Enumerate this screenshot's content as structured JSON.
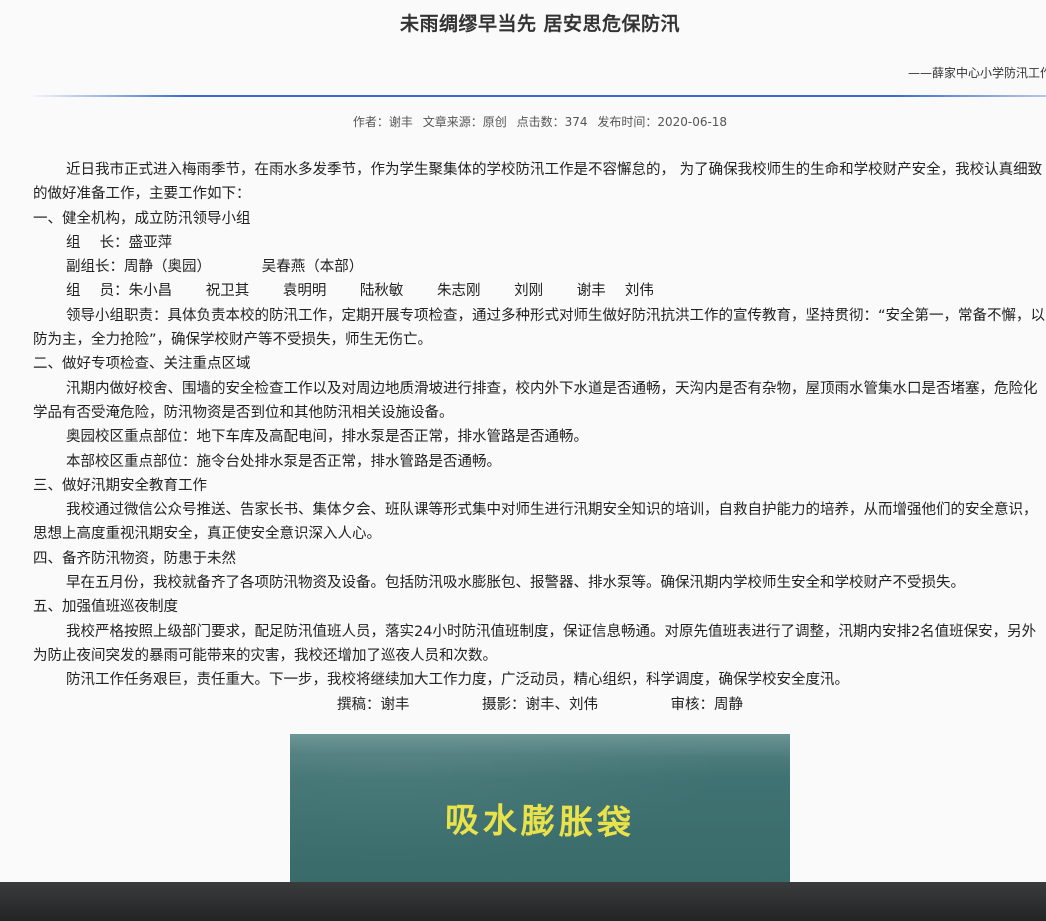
{
  "article": {
    "title": "未雨绸缪早当先 居安思危保防汛",
    "subtitle": "——薛家中心小学防汛工作",
    "meta": {
      "author": "作者：谢丰",
      "source": "文章来源：原创",
      "clicks": "点击数：374",
      "date": "发布时间：2020-06-18"
    },
    "paragraphs": {
      "intro": "近日我市正式进入梅雨季节，在雨水多发季节，作为学生聚集体的学校防汛工作是不容懈怠的， 为了确保我校师生的生命和学校财产安全，我校认真细致的做好准备工作，主要工作如下：",
      "h1": "一、健全机构，成立防汛领导小组",
      "leader": "组　 长：盛亚萍",
      "deputy": "副组长：周静（奥园）　　　　吴春燕（本部）",
      "members": "组　 员：朱小昌　　 祝卫其　　 袁明明　　 陆秋敏　　 朱志刚　　 刘刚　　 谢丰　 刘伟",
      "duty": "领导小组职责：具体负责本校的防汛工作，定期开展专项检查，通过多种形式对师生做好防汛抗洪工作的宣传教育，坚持贯彻：“安全第一，常备不懈，以防为主，全力抢险”，确保学校财产等不受损失，师生无伤亡。",
      "h2": "二、做好专项检查、关注重点区域",
      "check": "汛期内做好校舍、围墙的安全检查工作以及对周边地质滑坡进行排查，校内外下水道是否通畅，天沟内是否有杂物，屋顶雨水管集水口是否堵塞，危险化学品有否受淹危险，防汛物资是否到位和其他防汛相关设施设备。",
      "aoyuan": "奥园校区重点部位：地下车库及高配电间，排水泵是否正常，排水管路是否通畅。",
      "benbu": "本部校区重点部位：施令台处排水泵是否正常，排水管路是否通畅。",
      "h3": "三、做好汛期安全教育工作",
      "edu": "我校通过微信公众号推送、告家长书、集体夕会、班队课等形式集中对师生进行汛期安全知识的培训，自救自护能力的培养，从而增强他们的安全意识，思想上高度重视汛期安全，真正使安全意识深入人心。",
      "h4": "四、备齐防汛物资，防患于未然",
      "supplies": "早在五月份，我校就备齐了各项防汛物资及设备。包括防汛吸水膨胀包、报警器、排水泵等。确保汛期内学校师生安全和学校财产不受损失。",
      "h5": "五、加强值班巡夜制度",
      "duty2": "我校严格按照上级部门要求，配足防汛值班人员，落实24小时防汛值班制度，保证信息畅通。对原先值班表进行了调整，汛期内安排2名值班保安，另外为防止夜间突发的暴雨可能带来的灾害，我校还增加了巡夜人员和次数。",
      "closing": "防汛工作任务艰巨，责任重大。下一步，我校将继续加大工作力度，广泛动员，精心组织，科学调度，确保学校安全度汛。",
      "credits": "撰稿：谢丰　　　　　摄影：谢丰、刘伟　　　　　审核：周静"
    },
    "photo": {
      "label": "吸水膨胀袋"
    }
  }
}
